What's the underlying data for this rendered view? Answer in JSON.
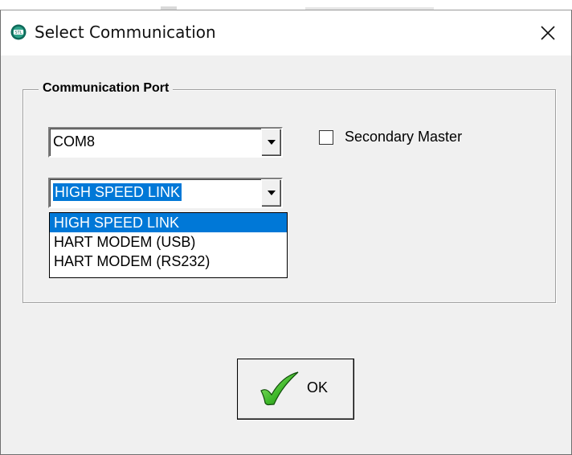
{
  "window": {
    "title": "Select Communication",
    "close_glyph": "✕",
    "app_icon": "stl-app-icon"
  },
  "group": {
    "label": "Communication Port",
    "port_combo": {
      "value": "COM8"
    },
    "link_combo": {
      "value": "HIGH SPEED LINK"
    },
    "link_options": [
      "HIGH SPEED LINK",
      "HART MODEM (USB)",
      "HART MODEM (RS232)"
    ],
    "secondary_master": {
      "label": "Secondary Master",
      "checked": false
    }
  },
  "ok_button": {
    "label": "OK",
    "icon": "checkmark-icon"
  },
  "colors": {
    "selection": "#0078d7",
    "face": "#f0f0f0",
    "titlebar": "#ffffff"
  }
}
